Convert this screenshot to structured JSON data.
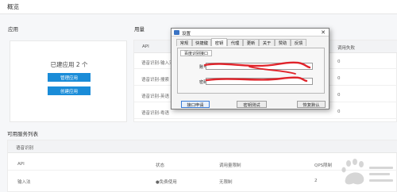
{
  "page": {
    "title": "概览"
  },
  "apps": {
    "section_label": "应用",
    "count_text": "已建应用 2 个",
    "manage_button": "管理应用",
    "create_button": "创建应用"
  },
  "usage": {
    "section_label": "用量",
    "col_api": "API",
    "col_fail": "调用失败",
    "rows": [
      {
        "label": "语音识别-输入法",
        "value": "0"
      },
      {
        "label": "语音识别-搜索",
        "value": "0"
      },
      {
        "label": "语音识别-英语",
        "value": "0"
      },
      {
        "label": "语音识别-粤语",
        "value": "0"
      }
    ]
  },
  "services": {
    "title": "可用服务列表",
    "group": "语音识别",
    "headers": {
      "api": "API",
      "status": "状态",
      "limit": "调用量限制",
      "qps": "QPS限制"
    },
    "row": {
      "api": "输入法",
      "status": "●免费使用",
      "limit": "无限制",
      "qps": "2"
    }
  },
  "dialog": {
    "title": "设置",
    "close": "✕",
    "tabs": [
      "常规",
      "快捷键",
      "密钥",
      "代理",
      "更新",
      "关于",
      "赞助",
      "反馈"
    ],
    "active_tab": "密钥",
    "group_tab": "百度识别接口",
    "key_label": "账号：",
    "key_value": "",
    "secret_label": "密码：",
    "secret_value": "",
    "btn_apply": "接口申请",
    "btn_test": "密钥测试",
    "btn_reset": "恢复默认"
  },
  "colors": {
    "accent": "#1a8cd8",
    "redaction": "#e0232a",
    "dialog_focus": "#3a7bd5"
  },
  "icons": {
    "app_icon": "settings-app-icon",
    "close_icon": "close-icon",
    "watermark": "baidu-paw-watermark"
  }
}
